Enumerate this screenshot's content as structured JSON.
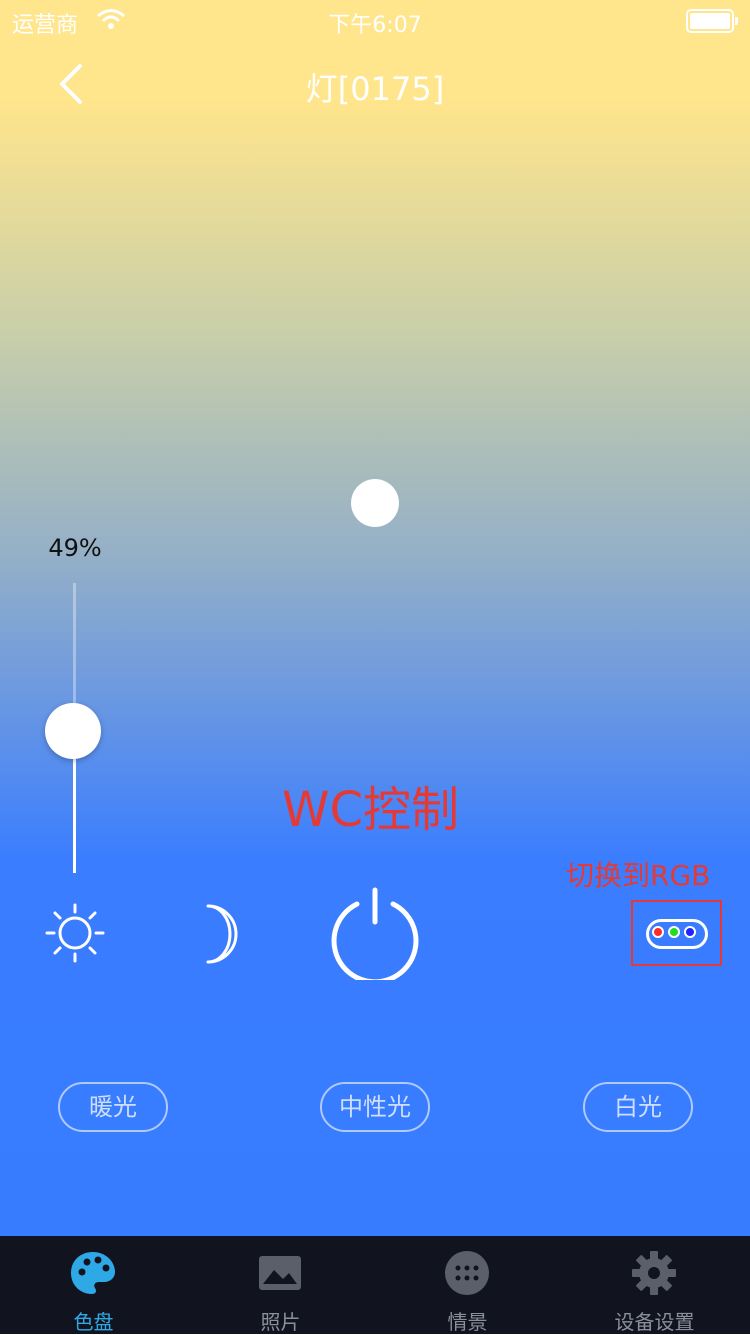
{
  "status_bar": {
    "carrier": "运营商",
    "time": "下午6:07"
  },
  "nav": {
    "title": "灯[0175]"
  },
  "brightness": {
    "label": "49%",
    "level": 0.49
  },
  "annotations": {
    "wc_control": "WC控制",
    "switch_rgb": "切换到RGB"
  },
  "rgb_dots": [
    "#FF2A2A",
    "#22DD22",
    "#2222FF"
  ],
  "presets": [
    {
      "label": "暖光"
    },
    {
      "label": "中性光"
    },
    {
      "label": "白光"
    }
  ],
  "tabs": [
    {
      "label": "色盘",
      "icon": "palette-icon",
      "active": true
    },
    {
      "label": "照片",
      "icon": "photo-icon",
      "active": false
    },
    {
      "label": "情景",
      "icon": "scene-icon",
      "active": false
    },
    {
      "label": "设备设置",
      "icon": "gear-icon",
      "active": false
    }
  ],
  "colors": {
    "accent": "#2FA9E6",
    "annotation": "#E53935",
    "tabbar_bg": "#11141F"
  }
}
